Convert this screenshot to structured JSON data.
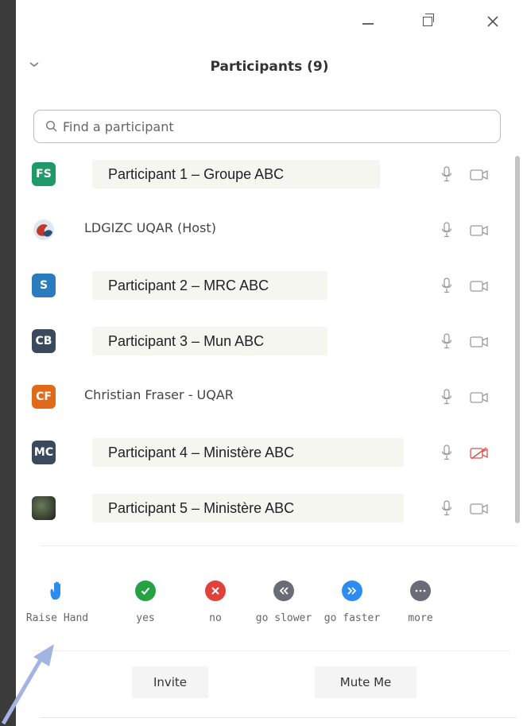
{
  "window": {
    "controls": [
      "minimize",
      "restore",
      "close"
    ]
  },
  "panel": {
    "title": "Participants (9)"
  },
  "search": {
    "placeholder": "Find a participant"
  },
  "participants": [
    {
      "initials": "FS",
      "name": "Participant 1 – Groupe ABC",
      "avatar_color": "#1e9a6a",
      "muted": true,
      "video_off": true,
      "video_blocked": false
    },
    {
      "initials": "",
      "name": "LDGIZC UQAR (Host)",
      "avatar_color": "#c0392b",
      "muted": true,
      "video_off": true,
      "video_blocked": false
    },
    {
      "initials": "S",
      "name": "Participant 2 – MRC ABC",
      "avatar_color": "#2b7bbf",
      "muted": true,
      "video_off": true,
      "video_blocked": false
    },
    {
      "initials": "CB",
      "name": "Participant 3 – Mun ABC",
      "avatar_color": "#3a4a5c",
      "muted": true,
      "video_off": true,
      "video_blocked": false
    },
    {
      "initials": "CF",
      "name": "Christian Fraser - UQAR",
      "avatar_color": "#e06a1a",
      "muted": true,
      "video_off": true,
      "video_blocked": false
    },
    {
      "initials": "MC",
      "name": "Participant 4 – Ministère ABC",
      "avatar_color": "#3a4a5c",
      "muted": true,
      "video_off": true,
      "video_blocked": true
    },
    {
      "initials": "",
      "name": "Participant 5 – Ministère ABC",
      "avatar_color": "#2a2a2a",
      "muted": true,
      "video_off": true,
      "video_blocked": false
    }
  ],
  "reactions": [
    {
      "label": "Raise Hand",
      "icon": "raise-hand-icon",
      "color": "#2d8cf0"
    },
    {
      "label": "yes",
      "icon": "check-icon",
      "color": "#25a244"
    },
    {
      "label": "no",
      "icon": "x-icon",
      "color": "#e0413b"
    },
    {
      "label": "go slower",
      "icon": "rewind-icon",
      "color": "#6b6b78"
    },
    {
      "label": "go faster",
      "icon": "fast-forward-icon",
      "color": "#2d8cf0"
    },
    {
      "label": "more",
      "icon": "more-icon",
      "color": "#6b6b78"
    }
  ],
  "footer": {
    "invite_label": "Invite",
    "mute_label": "Mute Me"
  },
  "colors": {
    "annotation_arrow": "#a3b3e2",
    "label_highlight": "#f6f6f0"
  }
}
